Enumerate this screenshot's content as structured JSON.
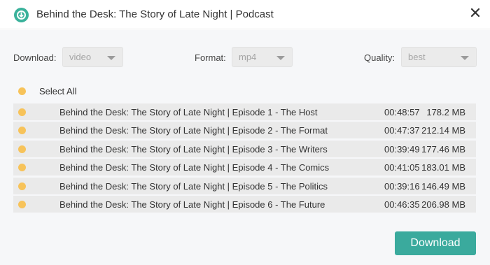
{
  "window": {
    "title": "Behind the Desk: The Story of Late Night | Podcast"
  },
  "options": {
    "download_label": "Download:",
    "download_value": "video",
    "format_label": "Format:",
    "format_value": "mp4",
    "quality_label": "Quality:",
    "quality_value": "best"
  },
  "select_all_label": "Select All",
  "episodes": [
    {
      "title": "Behind the Desk: The Story of Late Night | Episode 1 - The Host",
      "duration": "00:48:57",
      "size": "178.2 MB"
    },
    {
      "title": "Behind the Desk: The Story of Late Night | Episode 2 - The Format",
      "duration": "00:47:37",
      "size": "212.14 MB"
    },
    {
      "title": "Behind the Desk: The Story of Late Night | Episode 3 - The Writers",
      "duration": "00:39:49",
      "size": "177.46 MB"
    },
    {
      "title": "Behind the Desk: The Story of Late Night | Episode 4 - The Comics",
      "duration": "00:41:05",
      "size": "183.01 MB"
    },
    {
      "title": "Behind the Desk: The Story of Late Night | Episode 5 - The Politics",
      "duration": "00:39:16",
      "size": "146.49 MB"
    },
    {
      "title": "Behind the Desk: The Story of Late Night | Episode 6 - The Future",
      "duration": "00:46:35",
      "size": "206.98 MB"
    }
  ],
  "download_button_label": "Download",
  "icons": {
    "app": "app-logo-icon",
    "close": "close-icon",
    "select_caret": "chevron-down-icon"
  },
  "colors": {
    "accent": "#3aaa9d",
    "checkbox": "#f7c35a",
    "app_icon": "#3ab29b"
  }
}
